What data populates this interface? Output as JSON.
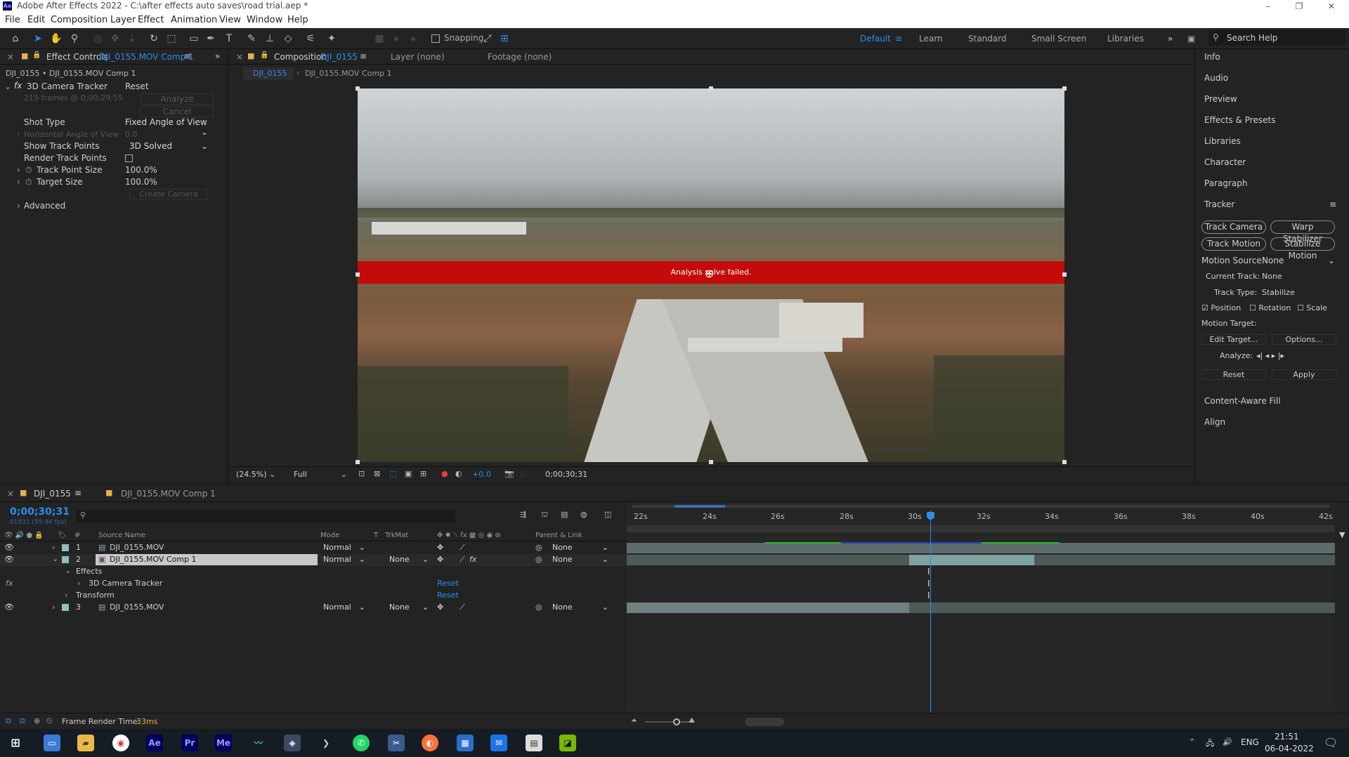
{
  "window": {
    "title": "Adobe After Effects 2022 - C:\\after effects auto saves\\road trial.aep *"
  },
  "menu": [
    "File",
    "Edit",
    "Composition",
    "Layer",
    "Effect",
    "Animation",
    "View",
    "Window",
    "Help"
  ],
  "toolbar": {
    "snapping": "Snapping",
    "workspaces": [
      "Default",
      "Learn",
      "Standard",
      "Small Screen",
      "Libraries"
    ],
    "search_help": "Search Help"
  },
  "effect_controls": {
    "tab_label": "Effect Controls",
    "tab_target": "DJI_0155.MOV Comp 1",
    "breadcrumb": "DJI_0155 • DJI_0155.MOV Comp 1",
    "effect_name": "3D Camera Tracker",
    "reset": "Reset",
    "frames_info": "219 frames @ 0;00;29;55",
    "analyze": "Analyze",
    "cancel": "Cancel",
    "shot_type_label": "Shot Type",
    "shot_type_value": "Fixed Angle of View",
    "hfov_label": "Horizontal Angle of View",
    "hfov_value": "0.0",
    "show_track_points_label": "Show Track Points",
    "show_track_points_value": "3D Solved",
    "render_track_points_label": "Render Track Points",
    "track_point_size_label": "Track Point Size",
    "track_point_size_value": "100.0",
    "target_size_label": "Target Size",
    "target_size_value": "100.0",
    "percent": "%",
    "create_camera": "Create Camera",
    "advanced": "Advanced"
  },
  "composition": {
    "tab_label": "Composition",
    "tab_target": "DJI_0155",
    "layer_tab": "Layer (none)",
    "footage_tab": "Footage (none)",
    "crumbs": [
      "DJI_0155",
      "DJI_0155.MOV Comp 1"
    ],
    "banner": "Analysis solve failed.",
    "zoom": "(24.5%)",
    "resolution": "Full",
    "exposure": "+0.0",
    "timecode": "0;00;30;31"
  },
  "right_panels": [
    "Info",
    "Audio",
    "Preview",
    "Effects & Presets",
    "Libraries",
    "Character",
    "Paragraph"
  ],
  "tracker": {
    "title": "Tracker",
    "buttons": [
      "Track Camera",
      "Warp Stabilizer",
      "Track Motion",
      "Stabilize Motion"
    ],
    "motion_source_label": "Motion Source:",
    "motion_source_value": "None",
    "current_track_label": "Current Track:",
    "current_track_value": "None",
    "track_type_label": "Track Type:",
    "track_type_value": "Stabilize",
    "position": "Position",
    "rotation": "Rotation",
    "scale": "Scale",
    "motion_target": "Motion Target:",
    "edit_target": "Edit Target...",
    "options": "Options...",
    "analyze": "Analyze:",
    "reset": "Reset",
    "apply": "Apply"
  },
  "bottom_panels": [
    "Content-Aware Fill",
    "Align"
  ],
  "timeline": {
    "tab1": "DJI_0155",
    "tab2": "DJI_0155.MOV Comp 1",
    "timecode": "0;00;30;31",
    "frame_info": "01831 (59.94 fps)",
    "col_source": "Source Name",
    "col_mode": "Mode",
    "col_t": "T",
    "col_trkmat": "TrkMat",
    "col_parent": "Parent & Link",
    "ruler": [
      "22s",
      "24s",
      "26s",
      "28s",
      "30s",
      "32s",
      "34s",
      "36s",
      "38s",
      "40s",
      "42s"
    ],
    "layers": [
      {
        "num": "1",
        "name": "DJI_0155.MOV",
        "mode": "Normal",
        "trkmat": "",
        "parent": "None"
      },
      {
        "num": "2",
        "name": "DJI_0155.MOV Comp 1",
        "mode": "Normal",
        "trkmat": "None",
        "parent": "None"
      },
      {
        "num": "3",
        "name": "DJI_0155.MOV",
        "mode": "Normal",
        "trkmat": "None",
        "parent": "None"
      }
    ],
    "effects_label": "Effects",
    "effect_item": "3D Camera Tracker",
    "transform_label": "Transform",
    "reset": "Reset",
    "frame_render_label": "Frame Render Time:",
    "frame_render_value": "33ms"
  },
  "taskbar": {
    "time": "21:51",
    "date": "06-04-2022",
    "lang": "ENG"
  }
}
